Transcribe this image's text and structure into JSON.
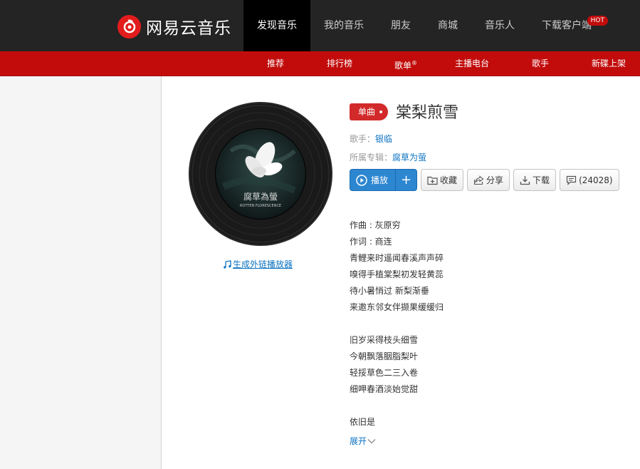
{
  "header": {
    "logo_text": "网易云音乐",
    "nav": [
      {
        "label": "发现音乐"
      },
      {
        "label": "我的音乐"
      },
      {
        "label": "朋友"
      },
      {
        "label": "商城"
      },
      {
        "label": "音乐人"
      },
      {
        "label": "下载客户端"
      }
    ],
    "hot_badge": "HOT",
    "brand_color": "#c20c0c"
  },
  "subnav": {
    "items": [
      {
        "label": "推荐"
      },
      {
        "label": "排行榜"
      },
      {
        "label": "歌单"
      },
      {
        "label": "主播电台"
      },
      {
        "label": "歌手"
      },
      {
        "label": "新碟上架"
      }
    ]
  },
  "song": {
    "tag": "单曲",
    "title": "棠梨煎雪",
    "singer_label": "歌手：",
    "singer": "银临",
    "album_label": "所属专辑：",
    "album": "腐草为萤",
    "cover_text": "腐草為螢",
    "cover_subtext": "ROTTEN FLORESCENCE"
  },
  "actions": {
    "play": "播放",
    "add": "+",
    "collect": "收藏",
    "share": "分享",
    "download": "下载",
    "comments": "(24028)"
  },
  "player_link": "生成外链播放器",
  "lyrics": [
    "作曲 : 灰原穷",
    "作词 : 商连",
    "青鲤来时遥闻春溪声声碎",
    "嗅得手植棠梨初发轻黄蕊",
    "待小暑悄过 新梨渐垂",
    "来邀东邻女伴撷果缓缓归",
    "",
    "旧岁采得枝头细雪",
    "今朝飘落胭脂梨叶",
    "轻挼草色二三入卷",
    "细呷春酒淡始觉甜",
    "",
    "依旧是"
  ],
  "expand": "展开"
}
